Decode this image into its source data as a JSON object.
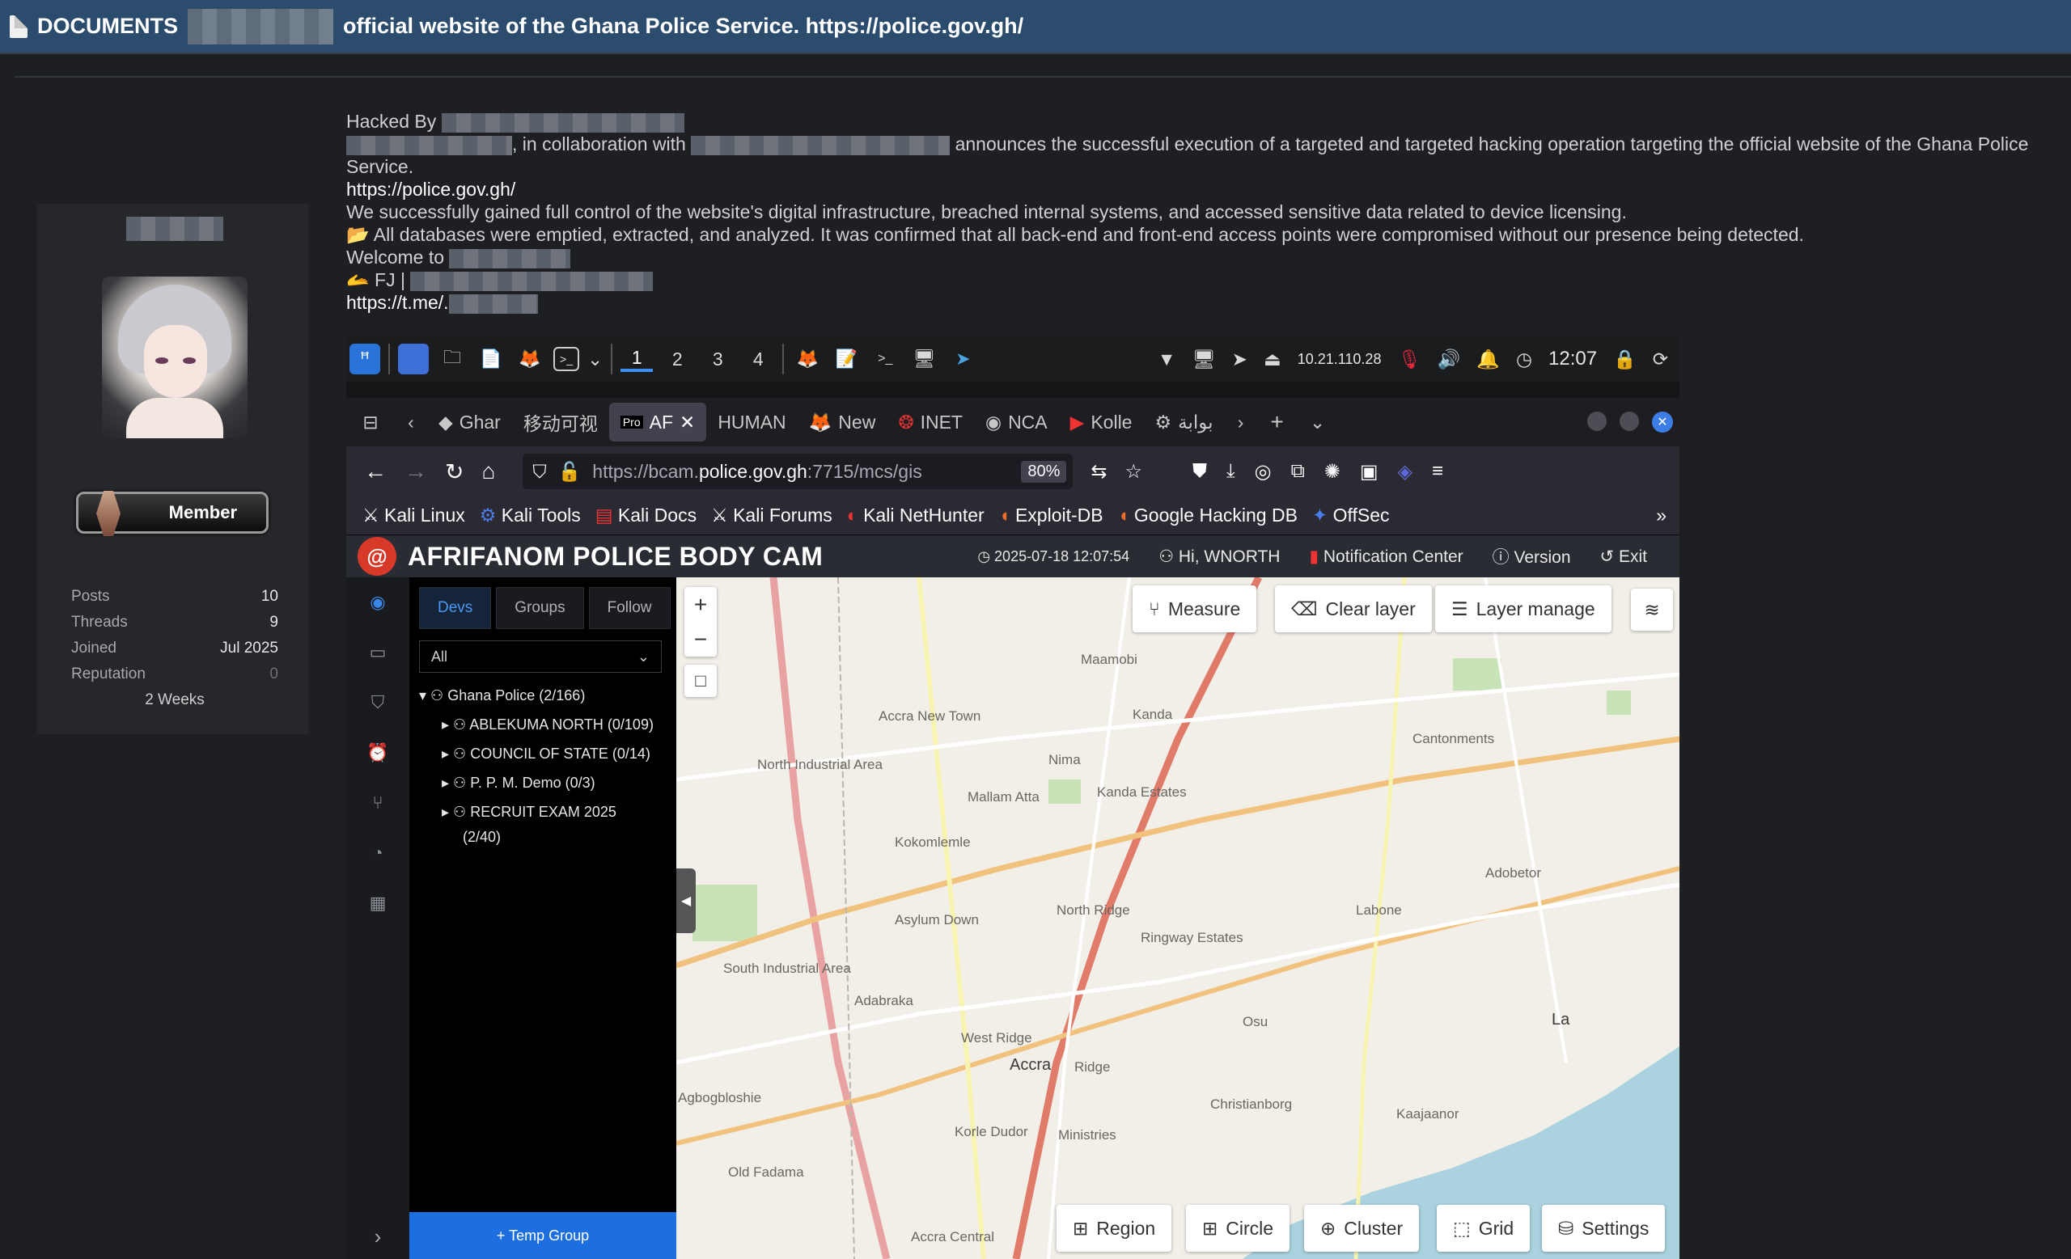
{
  "window": {
    "category": "DOCUMENTS",
    "title": "official website of the Ghana Police Service. https://police.gov.gh/"
  },
  "profile": {
    "rank": "Member",
    "stats": [
      {
        "label": "Posts",
        "value": "10"
      },
      {
        "label": "Threads",
        "value": "9"
      },
      {
        "label": "Joined",
        "value": "Jul 2025"
      },
      {
        "label": "Reputation",
        "value": "0"
      }
    ],
    "active": "2 Weeks"
  },
  "post": {
    "hacked_by": "Hacked By",
    "collab_text": ", in collaboration with",
    "announce_text": "announces the successful execution of a targeted and targeted hacking operation targeting the official website of the Ghana Police Service.",
    "link1": "https://police.gov.gh/",
    "line_control": "We successfully gained full control of the website's digital infrastructure, breached internal systems, and accessed sensitive data related to device licensing.",
    "line_databases": "All databases were emptied, extracted, and analyzed. It was confirmed that all back-end and front-end access points were compromised without our presence being detected.",
    "welcome": "Welcome to",
    "fj": "FJ |",
    "link2": "https://t.me/."
  },
  "kali_bar": {
    "workspaces": [
      "1",
      "2",
      "3",
      "4"
    ],
    "ip": "10.21.110.28",
    "time": "12:07"
  },
  "browser": {
    "tabs": [
      {
        "label": "Ghar",
        "active": false
      },
      {
        "label": "移动可视",
        "active": false
      },
      {
        "label": "AF",
        "active": true
      },
      {
        "label": "HUMAN",
        "active": false
      },
      {
        "label": "New",
        "active": false
      },
      {
        "label": "INET",
        "active": false
      },
      {
        "label": "NCA",
        "active": false
      },
      {
        "label": "Kolle",
        "active": false
      },
      {
        "label": "بوابة",
        "active": false
      }
    ],
    "url_prefix": "https://bcam.",
    "url_host": "police.gov.gh",
    "url_suffix": ":7715/mcs/gis",
    "zoom": "80%",
    "bookmarks": [
      "Kali Linux",
      "Kali Tools",
      "Kali Docs",
      "Kali Forums",
      "Kali NetHunter",
      "Exploit-DB",
      "Google Hacking DB",
      "OffSec"
    ]
  },
  "app": {
    "title": "AFRIFANOM POLICE BODY CAM",
    "datetime": "2025-07-18 12:07:54",
    "user": "Hi, WNORTH",
    "notification": "Notification Center",
    "version": "Version",
    "exit": "Exit",
    "tree_tabs": [
      "Devs",
      "Groups",
      "Follow"
    ],
    "filter": "All",
    "root": "Ghana Police (2/166)",
    "children": [
      "ABLEKUMA NORTH (0/109)",
      "COUNCIL OF STATE (0/14)",
      "P. P. M. Demo (0/3)",
      "RECRUIT EXAM 2025"
    ],
    "child_extra": "(2/40)",
    "temp_group": "+ Temp Group",
    "map_tools_top": [
      "Measure",
      "Clear layer",
      "Layer manage"
    ],
    "map_tools_bottom": [
      "Region",
      "Circle",
      "Cluster",
      "Grid",
      "Settings"
    ],
    "map_labels": [
      "Maamobi",
      "Kanda",
      "Cantonments",
      "Accra New Town",
      "North Industrial Area",
      "Nima",
      "Mallam Atta",
      "Kanda Estates",
      "Kokomlemle",
      "Adobetor",
      "Asylum Down",
      "North Ridge",
      "Ringway Estates",
      "Labone",
      "South Industrial Area",
      "Adabraka",
      "West Ridge",
      "Osu",
      "Accra",
      "Ridge",
      "La",
      "Korle Dudor",
      "Old Fadama",
      "Ministries",
      "Kaajaanor",
      "Christianborg",
      "Accra Central",
      "Agbogbloshie"
    ]
  }
}
